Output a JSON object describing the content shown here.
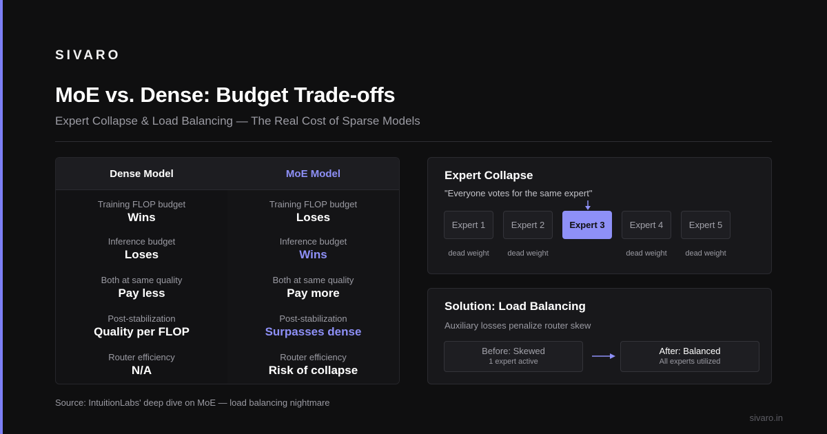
{
  "brand": "SIVARO",
  "title": "MoE vs. Dense: Budget Trade-offs",
  "subtitle": "Expert Collapse & Load Balancing — The Real Cost of Sparse Models",
  "accent_color": "#7c7ff5",
  "highlight_color": "#8e90f7",
  "comparison": {
    "headers": {
      "dense": "Dense Model",
      "moe": "MoE Model"
    },
    "rows": [
      {
        "label": "Training FLOP budget",
        "dense": "Wins",
        "moe": "Loses"
      },
      {
        "label": "Inference budget",
        "dense": "Loses",
        "moe": "Wins"
      },
      {
        "label": "Both at same quality",
        "dense": "Pay less",
        "moe": "Pay more"
      },
      {
        "label": "Post-stabilization",
        "dense": "Quality per FLOP",
        "moe": "Surpasses dense"
      },
      {
        "label": "Router efficiency",
        "dense": "N/A",
        "moe": "Risk of collapse"
      }
    ]
  },
  "collapse_panel": {
    "title": "Expert Collapse",
    "quote": "\"Everyone votes for the same expert\"",
    "experts": [
      {
        "label": "Expert 1",
        "note": "dead weight"
      },
      {
        "label": "Expert 2",
        "note": "dead weight"
      },
      {
        "label": "Expert 3",
        "note": ""
      },
      {
        "label": "Expert 4",
        "note": "dead weight"
      },
      {
        "label": "Expert 5",
        "note": "dead weight"
      }
    ],
    "active_expert": "Expert 3"
  },
  "solution_panel": {
    "title": "Solution: Load Balancing",
    "description": "Auxiliary losses penalize router skew",
    "before": {
      "title": "Before: Skewed",
      "sub": "1 expert active"
    },
    "after": {
      "title": "After: Balanced",
      "sub": "All experts utilized"
    }
  },
  "source": "Source: IntuitionLabs' deep dive on MoE — load balancing nightmare",
  "domain": "sivaro.in"
}
